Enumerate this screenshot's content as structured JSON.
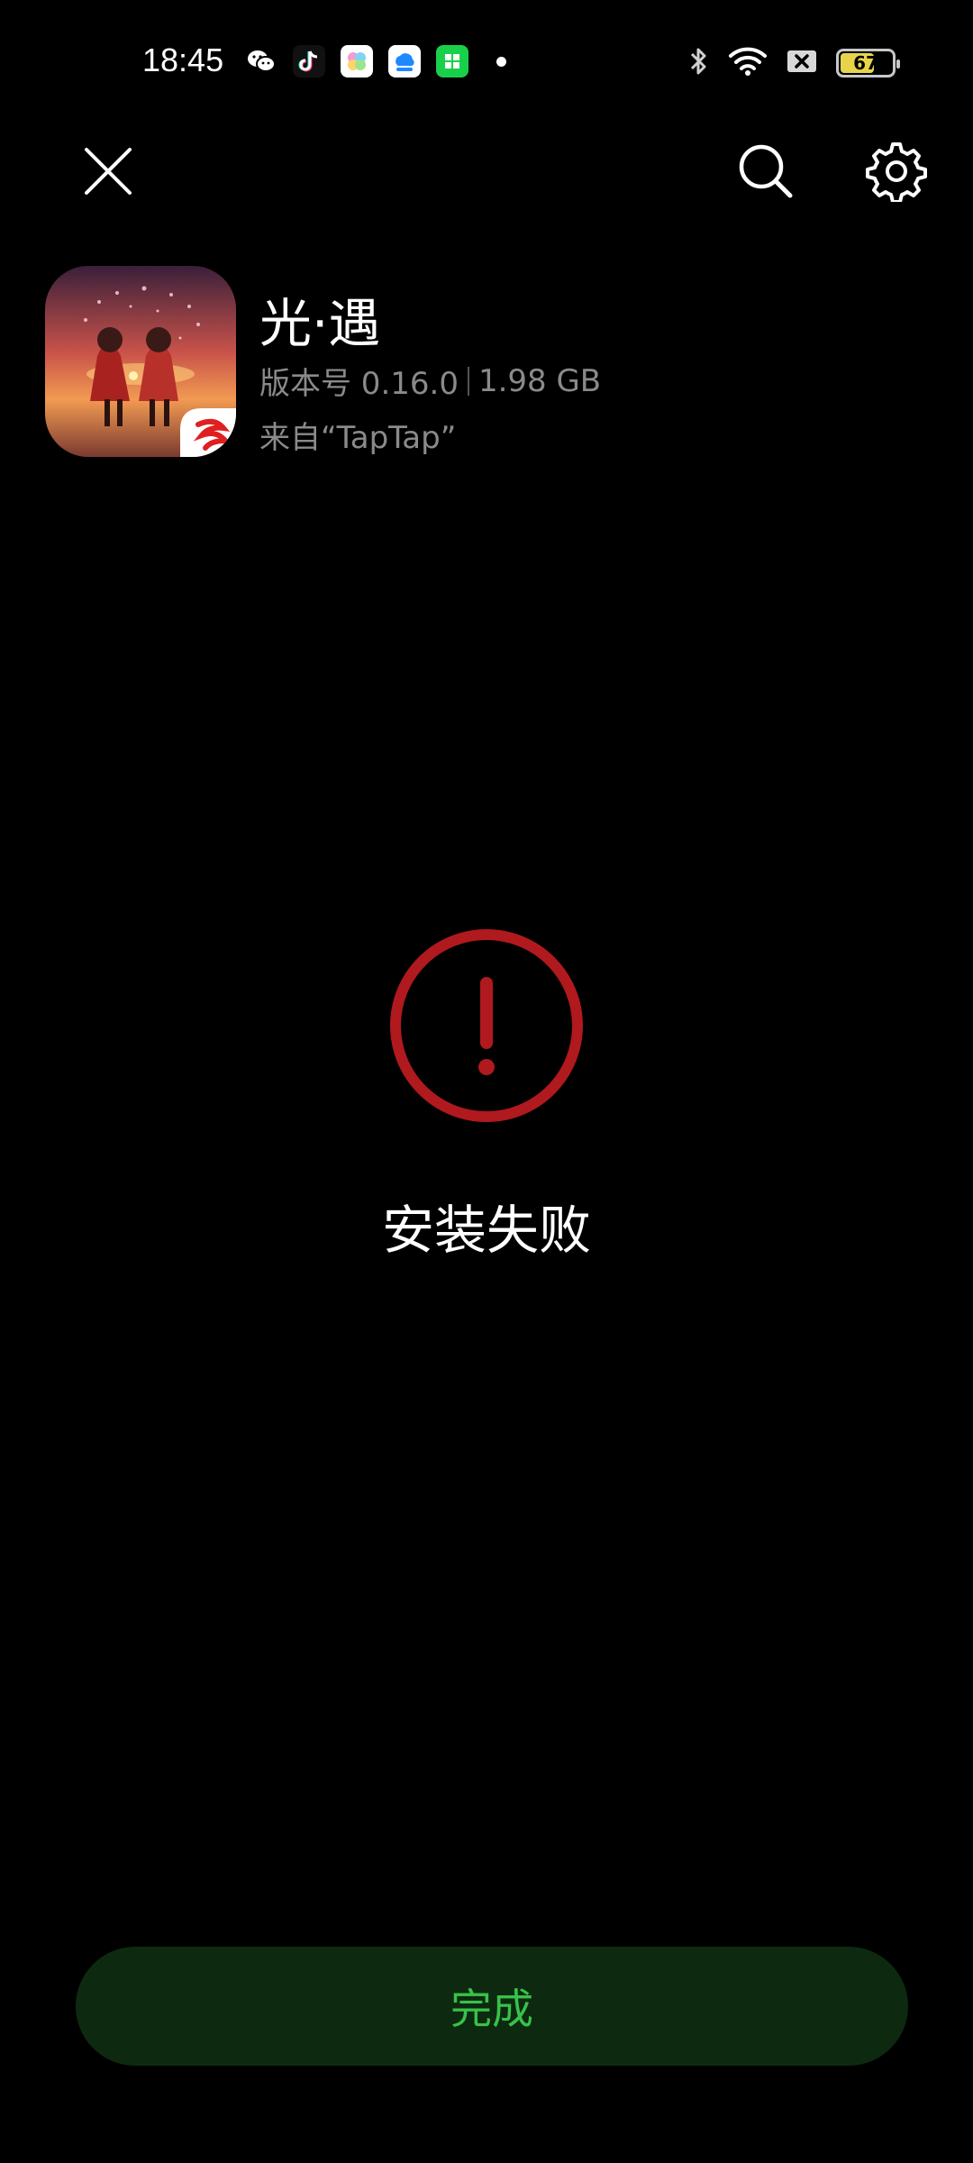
{
  "status_bar": {
    "time": "18:45",
    "notification_icons": [
      "wechat-icon",
      "tiktok-icon",
      "photo-app-icon",
      "cloud-app-icon",
      "store-app-icon"
    ],
    "battery_level": "67",
    "battery_fraction": 0.67
  },
  "toolbar": {
    "close_icon": "close-icon",
    "search_icon": "search-icon",
    "settings_icon": "gear-icon"
  },
  "app": {
    "name": "光·遇",
    "version": "版本号 0.16.0",
    "size": "1.98 GB",
    "source": "来自“TapTap”"
  },
  "status": {
    "title": "安装失败",
    "color": "#b0191d"
  },
  "actions": {
    "done_label": "完成",
    "done_bg": "#0d2a10",
    "done_fg": "#37c24a"
  }
}
